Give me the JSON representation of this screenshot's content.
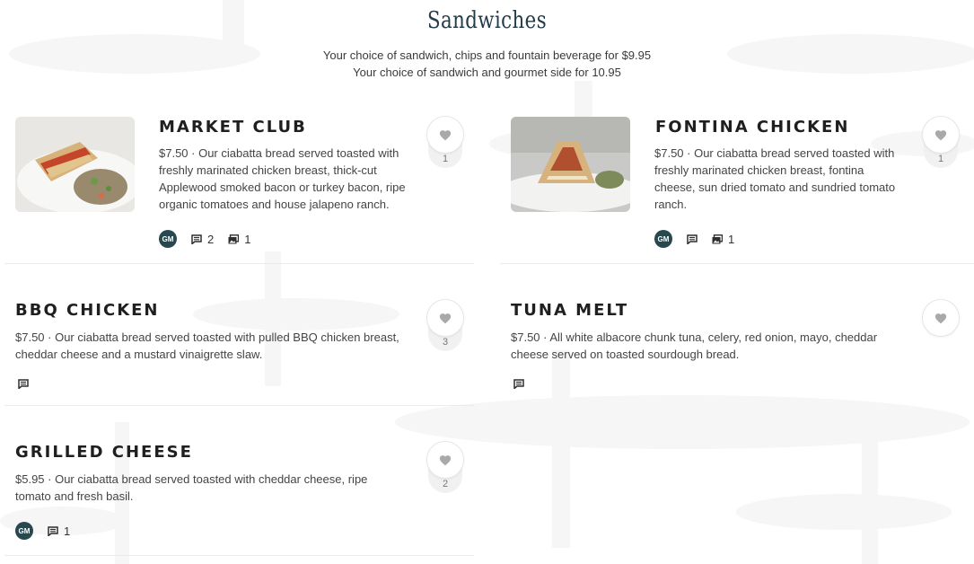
{
  "section": {
    "title": "Sandwiches",
    "promo_line_1": "Your choice of sandwich, chips and fountain beverage for $9.95",
    "promo_line_2": "Your choice of sandwich and gourmet side for 10.95"
  },
  "colors": {
    "title": "#243b4a",
    "badge": "#27484f",
    "heart": "#a9a9a9"
  },
  "items": [
    {
      "name": "MARKET CLUB",
      "description": "$7.50 · Our ciabatta bread served toasted with freshly marinated chicken breast, thick-cut Applewood smoked bacon or turkey bacon, ripe organic tomatoes and house jalapeno ranch.",
      "likes": "1",
      "badge": "GM",
      "comments": "2",
      "photos": "1"
    },
    {
      "name": "FONTINA CHICKEN",
      "description": "$7.50 · Our ciabatta bread served toasted with freshly marinated chicken breast, fontina cheese, sun dried tomato and sundried tomato ranch.",
      "likes": "1",
      "badge": "GM",
      "comments": "",
      "photos": "1"
    },
    {
      "name": "BBQ CHICKEN",
      "description": "$7.50 · Our ciabatta bread served toasted with pulled BBQ chicken breast, cheddar cheese and a mustard vinaigrette slaw.",
      "likes": "3"
    },
    {
      "name": "TUNA MELT",
      "description": "$7.50 · All white albacore chunk tuna, celery, red onion, mayo, cheddar cheese served on toasted sourdough bread."
    },
    {
      "name": "GRILLED CHEESE",
      "description": "$5.95 · Our ciabatta bread served toasted with cheddar cheese, ripe tomato and fresh basil.",
      "likes": "2",
      "badge": "GM",
      "comments": "1"
    }
  ],
  "icons": {
    "heart": "heart-icon",
    "comment": "comment-icon",
    "photo": "photo-icon"
  }
}
